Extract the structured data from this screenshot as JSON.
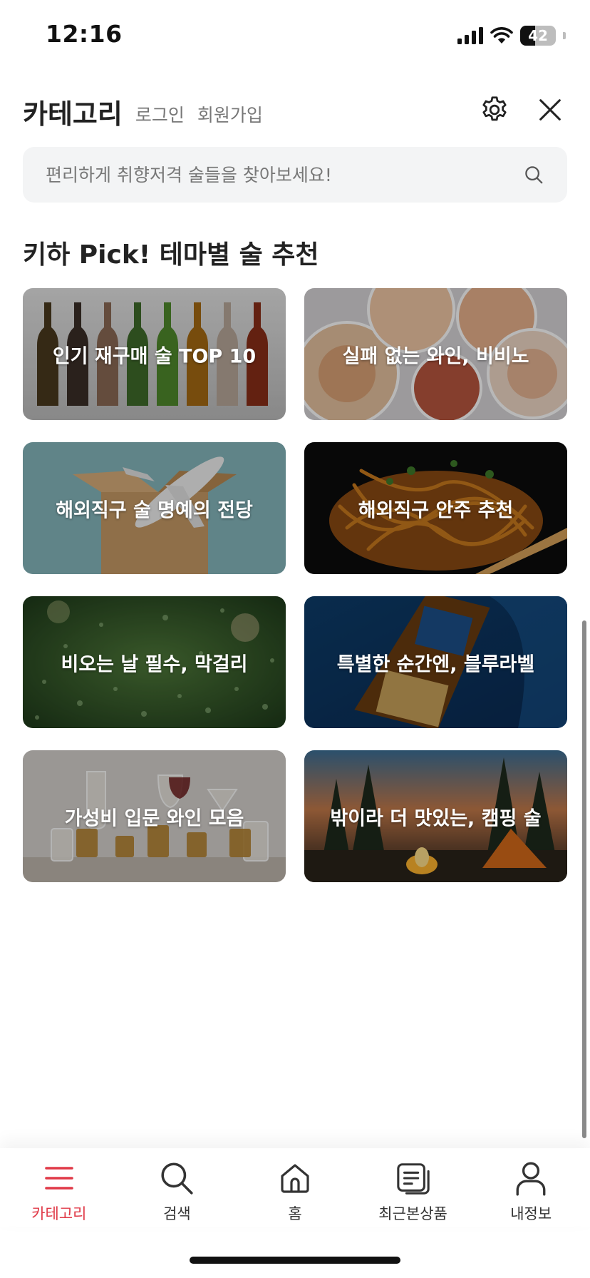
{
  "status_bar": {
    "time": "12:16",
    "battery": "42",
    "battery_level": 0.42
  },
  "header": {
    "title": "카테고리",
    "login": "로그인",
    "signup": "회원가입",
    "settings_icon": "gear-icon",
    "close_icon": "close-icon"
  },
  "search": {
    "placeholder": "편리하게 취향저격 술들을 찾아보세요!",
    "value": "",
    "icon": "search-icon"
  },
  "section": {
    "title": "키하 Pick! 테마별 술 추천"
  },
  "themes": [
    {
      "label": "인기 재구매 술 TOP 10",
      "image": "glass-bottles"
    },
    {
      "label": "실패 없는 와인, 비비노",
      "image": "wine-glasses"
    },
    {
      "label": "해외직구 술 명예의 전당",
      "image": "airplane-box"
    },
    {
      "label": "해외직구 안주  추천",
      "image": "noodles"
    },
    {
      "label": "비오는 날 필수, 막걸리",
      "image": "rainy-window"
    },
    {
      "label": "특별한 순간엔, 블루라벨",
      "image": "blue-label-bottle"
    },
    {
      "label": "가성비 입문 와인 모음",
      "image": "assorted-glasses"
    },
    {
      "label": "밖이라 더 맛있는, 캠핑 술",
      "image": "campfire"
    }
  ],
  "bottom_nav": [
    {
      "label": "카테고리",
      "icon": "menu-icon",
      "active": true
    },
    {
      "label": "검색",
      "icon": "search-icon",
      "active": false
    },
    {
      "label": "홈",
      "icon": "home-icon",
      "active": false
    },
    {
      "label": "최근본상품",
      "icon": "recent-items-icon",
      "active": false
    },
    {
      "label": "내정보",
      "icon": "profile-icon",
      "active": false
    }
  ],
  "colors": {
    "accent": "#e03a48",
    "text": "#222222",
    "muted": "#777777",
    "search_bg": "#f3f4f5"
  }
}
